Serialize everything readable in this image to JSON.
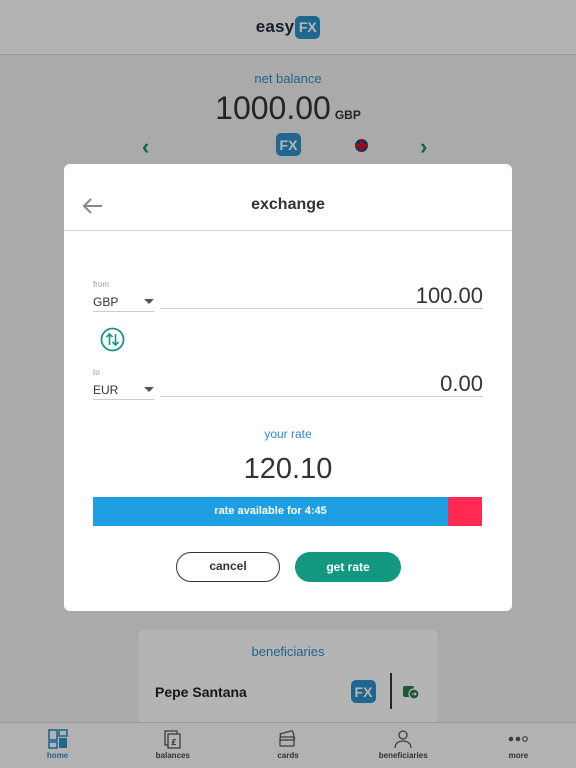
{
  "app": {
    "logo_text": "easy",
    "logo_badge": "FX"
  },
  "balance": {
    "label": "net balance",
    "amount": "1000.00",
    "currency": "GBP",
    "badge": "FX"
  },
  "beneficiaries_card": {
    "title": "beneficiaries",
    "name": "Pepe Santana",
    "badge": "FX"
  },
  "tabbar": {
    "items": [
      {
        "label": "home",
        "icon": "home-icon",
        "active": true
      },
      {
        "label": "balances",
        "icon": "balances-icon",
        "active": false
      },
      {
        "label": "cards",
        "icon": "cards-icon",
        "active": false
      },
      {
        "label": "beneficiaries",
        "icon": "beneficiaries-icon",
        "active": false
      },
      {
        "label": "more",
        "icon": "more-icon",
        "active": false
      }
    ]
  },
  "modal": {
    "title": "exchange",
    "from": {
      "label": "from",
      "currency": "GBP",
      "amount": "100.00"
    },
    "to": {
      "label": "to",
      "currency": "EUR",
      "amount": "0.00"
    },
    "rate_label": "your rate",
    "rate_value": "120.10",
    "timer_text": "rate available for 4:45",
    "timer_remaining_fraction": 0.913,
    "cancel_label": "cancel",
    "get_rate_label": "get rate"
  },
  "colors": {
    "accent_blue": "#2b8fc7",
    "timer_blue": "#1e9fe3",
    "timer_red": "#ff2a52",
    "primary_green": "#129880"
  }
}
